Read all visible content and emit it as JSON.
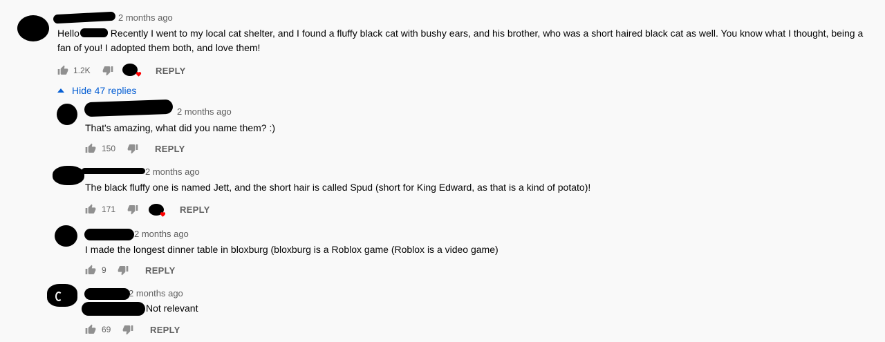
{
  "comment": {
    "time": "2 months ago",
    "text_before": "Hello",
    "text_after": " Recently I went to my local cat shelter, and I found a fluffy black cat with bushy ears, and his brother, who was a short haired black cat as well. You know what I thought, being a fan of you! I adopted them both, and love them!",
    "likes": "1.2K",
    "reply_label": "REPLY"
  },
  "replies_toggle": "Hide 47 replies",
  "replies": [
    {
      "time": "2 months ago",
      "text": "That's amazing, what did you name them? :)",
      "likes": "150",
      "reply_label": "REPLY"
    },
    {
      "time": "2 months ago",
      "text": "The black fluffy one is named Jett, and the short hair is called Spud (short for King Edward, as that is a kind of potato)!",
      "likes": "171",
      "reply_label": "REPLY"
    },
    {
      "time": "2 months ago",
      "text": "I made the longest dinner table in bloxburg (bloxburg is a Roblox game (Roblox is a video game)",
      "likes": "9",
      "reply_label": "REPLY"
    },
    {
      "time": "2 months ago",
      "text": "Not relevant",
      "likes": "69",
      "reply_label": "REPLY"
    }
  ],
  "colors": {
    "link": "#065fd4",
    "meta": "#606060",
    "heart": "#ff0000",
    "background": "#f9f9f9"
  },
  "icons": [
    "thumb-up-icon",
    "thumb-down-icon",
    "heart-icon",
    "caret-up-icon"
  ]
}
